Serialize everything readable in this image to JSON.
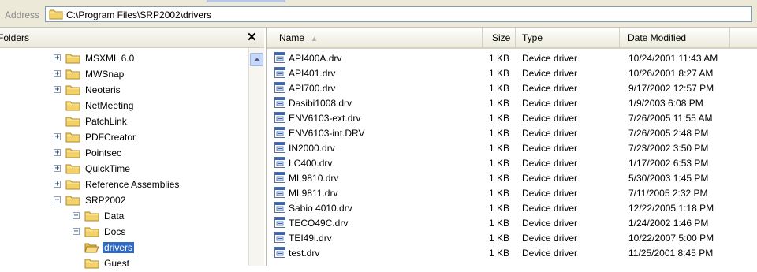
{
  "address": {
    "label": "Address",
    "path": "C:\\Program Files\\SRP2002\\drivers"
  },
  "folders_pane": {
    "title": "Folders",
    "close": "✕",
    "items": [
      {
        "label": "MSXML 6.0",
        "expander": "+"
      },
      {
        "label": "MWSnap",
        "expander": "+"
      },
      {
        "label": "Neoteris",
        "expander": "+"
      },
      {
        "label": "NetMeeting",
        "expander": ""
      },
      {
        "label": "PatchLink",
        "expander": ""
      },
      {
        "label": "PDFCreator",
        "expander": "+"
      },
      {
        "label": "Pointsec",
        "expander": "+"
      },
      {
        "label": "QuickTime",
        "expander": "+"
      },
      {
        "label": "Reference Assemblies",
        "expander": "+"
      },
      {
        "label": "SRP2002",
        "expander": "−"
      },
      {
        "label": "Data",
        "expander": "+"
      },
      {
        "label": "Docs",
        "expander": "+"
      },
      {
        "label": "drivers",
        "expander": "",
        "selected": true,
        "open": true
      },
      {
        "label": "Guest",
        "expander": ""
      }
    ]
  },
  "columns": {
    "name": "Name",
    "size": "Size",
    "type": "Type",
    "date": "Date Modified"
  },
  "files": [
    {
      "name": "API400A.drv",
      "size": "1 KB",
      "type": "Device driver",
      "date": "10/24/2001 11:43 AM"
    },
    {
      "name": "API401.drv",
      "size": "1 KB",
      "type": "Device driver",
      "date": "10/26/2001 8:27 AM"
    },
    {
      "name": "API700.drv",
      "size": "1 KB",
      "type": "Device driver",
      "date": "9/17/2002 12:57 PM"
    },
    {
      "name": "Dasibi1008.drv",
      "size": "1 KB",
      "type": "Device driver",
      "date": "1/9/2003 6:08 PM"
    },
    {
      "name": "ENV6103-ext.drv",
      "size": "1 KB",
      "type": "Device driver",
      "date": "7/26/2005 11:55 AM"
    },
    {
      "name": "ENV6103-int.DRV",
      "size": "1 KB",
      "type": "Device driver",
      "date": "7/26/2005 2:48 PM"
    },
    {
      "name": "IN2000.drv",
      "size": "1 KB",
      "type": "Device driver",
      "date": "7/23/2002 3:50 PM"
    },
    {
      "name": "LC400.drv",
      "size": "1 KB",
      "type": "Device driver",
      "date": "1/17/2002 6:53 PM"
    },
    {
      "name": "ML9810.drv",
      "size": "1 KB",
      "type": "Device driver",
      "date": "5/30/2003 1:45 PM"
    },
    {
      "name": "ML9811.drv",
      "size": "1 KB",
      "type": "Device driver",
      "date": "7/11/2005 2:32 PM"
    },
    {
      "name": "Sabio 4010.drv",
      "size": "1 KB",
      "type": "Device driver",
      "date": "12/22/2005 1:18 PM"
    },
    {
      "name": "TECO49C.drv",
      "size": "1 KB",
      "type": "Device driver",
      "date": "1/24/2002 1:46 PM"
    },
    {
      "name": "TEI49i.drv",
      "size": "1 KB",
      "type": "Device driver",
      "date": "10/22/2007 5:00 PM"
    },
    {
      "name": "test.drv",
      "size": "1 KB",
      "type": "Device driver",
      "date": "11/25/2001 8:45 PM"
    }
  ],
  "colors": {
    "selection": "#316ac5",
    "folder": "#f3d26b",
    "chrome": "#ece9d8"
  }
}
